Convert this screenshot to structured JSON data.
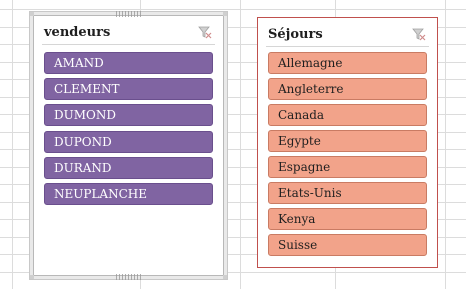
{
  "slicers": [
    {
      "title": "vendeurs",
      "color": "#8064a2",
      "items": [
        "AMAND",
        "CLEMENT",
        "DUMOND",
        "DUPOND",
        "DURAND",
        "NEUPLANCHE"
      ]
    },
    {
      "title": "Séjours",
      "color": "#f2a38a",
      "items": [
        "Allemagne",
        "Angleterre",
        "Canada",
        "Egypte",
        "Espagne",
        "Etats-Unis",
        "Kenya",
        "Suisse"
      ]
    }
  ],
  "icons": {
    "clear_filter": "clear-filter-icon"
  }
}
